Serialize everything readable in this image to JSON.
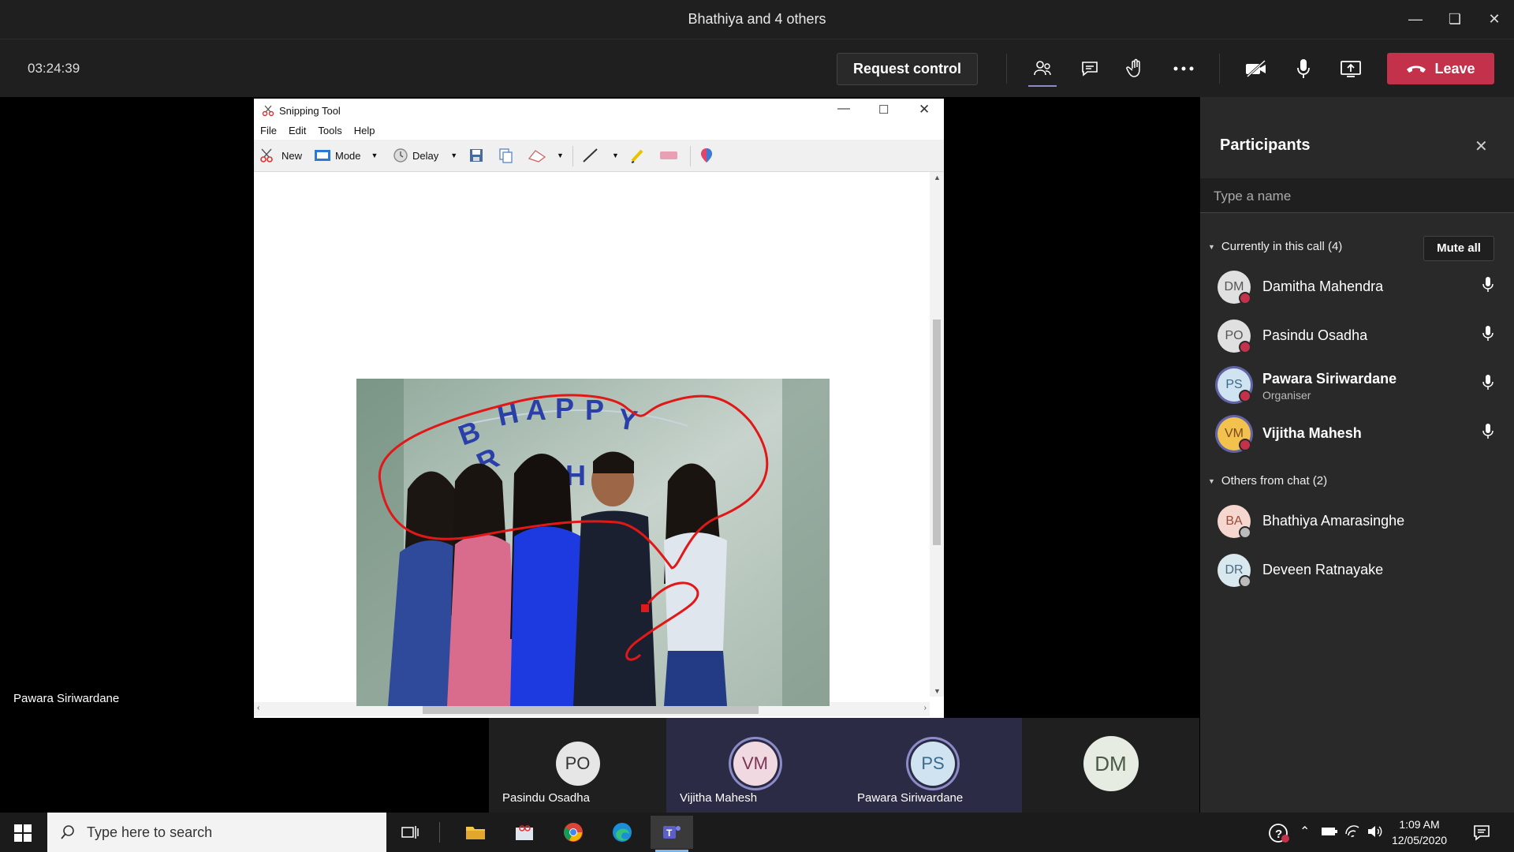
{
  "window": {
    "title": "Bhathiya and 4 others"
  },
  "toolbar": {
    "timer": "03:24:39",
    "request_control": "Request control",
    "leave": "Leave"
  },
  "stage": {
    "presenter_name": "Pawara Siriwardane"
  },
  "snipping_tool": {
    "title": "Snipping Tool",
    "menu": [
      "File",
      "Edit",
      "Tools",
      "Help"
    ],
    "new_label": "New",
    "mode_label": "Mode",
    "delay_label": "Delay"
  },
  "participants": {
    "title": "Participants",
    "search_placeholder": "Type a name",
    "in_call_header": "Currently in this call (4)",
    "mute_all": "Mute all",
    "in_call": [
      {
        "initials": "DM",
        "name": "Damitha Mahendra",
        "role": ""
      },
      {
        "initials": "PO",
        "name": "Pasindu Osadha",
        "role": ""
      },
      {
        "initials": "PS",
        "name": "Pawara Siriwardane",
        "role": "Organiser"
      },
      {
        "initials": "VM",
        "name": "Vijitha Mahesh",
        "role": ""
      }
    ],
    "others_header": "Others from chat (2)",
    "others": [
      {
        "initials": "BA",
        "name": "Bhathiya Amarasinghe"
      },
      {
        "initials": "DR",
        "name": "Deveen Ratnayake"
      }
    ]
  },
  "video_strip": [
    {
      "initials": "PO",
      "name": "Pasindu Osadha"
    },
    {
      "initials": "VM",
      "name": "Vijitha Mahesh"
    },
    {
      "initials": "PS",
      "name": "Pawara Siriwardane"
    },
    {
      "initials": "DM",
      "name": ""
    }
  ],
  "taskbar": {
    "search_placeholder": "Type here to search",
    "time": "1:09 AM",
    "date": "12/05/2020"
  },
  "colors": {
    "accent": "#6264a7",
    "leave": "#c4314b",
    "panel_bg": "#292929",
    "bar_bg": "#1f1f1f"
  }
}
